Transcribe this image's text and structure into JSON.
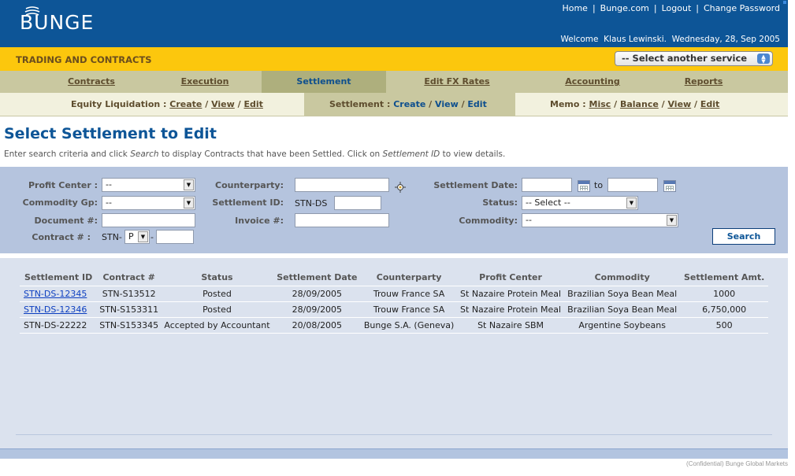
{
  "header": {
    "logo_text": "BUNGE",
    "links": [
      "Home",
      "Bunge.com",
      "Logout",
      "Change Password"
    ],
    "welcome": "Welcome  Klaus Lewinski.  Wednesday, 28, Sep 2005"
  },
  "service_bar": {
    "title": "TRADING AND CONTRACTS",
    "select_value": "-- Select another service"
  },
  "main_nav": [
    {
      "label": "Contracts"
    },
    {
      "label": "Execution"
    },
    {
      "label": "Settlement",
      "active": true
    },
    {
      "label": "Edit FX Rates"
    },
    {
      "label": "Accounting"
    },
    {
      "label": "Reports"
    }
  ],
  "sub_nav": {
    "equity": {
      "label": "Equity Liquidation :",
      "links": [
        "Create",
        "View",
        "Edit"
      ]
    },
    "settlement": {
      "label": "Settlement :",
      "links": [
        "Create",
        "View",
        "Edit"
      ]
    },
    "memo": {
      "label": "Memo :",
      "links": [
        "Misc",
        "Balance",
        "View",
        "Edit"
      ]
    }
  },
  "page": {
    "title": "Select Settlement to Edit",
    "instr_1": "Enter search criteria and click ",
    "instr_search": "Search",
    "instr_2": " to display Contracts that have been Settled. Click on ",
    "instr_sid": "Settlement ID",
    "instr_3": " to view details."
  },
  "search": {
    "profit_center_label": "Profit Center :",
    "profit_center_value": "--",
    "commodity_gp_label": "Commodity Gp:",
    "commodity_gp_value": "--",
    "document_label": "Document #:",
    "document_value": "",
    "contract_label": "Contract # :",
    "contract_prefix": "STN-",
    "contract_type_value": "P",
    "contract_dash": "-",
    "contract_value": "",
    "counterparty_label": "Counterparty:",
    "counterparty_value": "",
    "settlement_id_label": "Settlement ID:",
    "settlement_id_prefix": "STN-DS",
    "settlement_id_value": "",
    "invoice_label": "Invoice #:",
    "invoice_value": "",
    "settlement_date_label": "Settlement Date:",
    "date_from_value": "",
    "date_to_label": "to",
    "date_to_value": "",
    "status_label": "Status:",
    "status_value": "-- Select --",
    "commodity_label": "Commodity:",
    "commodity_value": "--",
    "search_button": "Search"
  },
  "results": {
    "columns": [
      "Settlement ID",
      "Contract #",
      "Status",
      "Settlement Date",
      "Counterparty",
      "Profit Center",
      "Commodity",
      "Settlement Amt."
    ],
    "rows": [
      [
        "STN-DS-12345",
        "STN-S13512",
        "Posted",
        "28/09/2005",
        "Trouw France SA",
        "St Nazaire Protein Meal",
        "Brazilian Soya Bean Meal",
        "1000"
      ],
      [
        "STN-DS-12346",
        "STN-S153311",
        "Posted",
        "28/09/2005",
        "Trouw France SA",
        "St Nazaire Protein Meal",
        "Brazilian Soya Bean Meal",
        "6,750,000"
      ],
      [
        "STN-DS-22222",
        "STN-S153345",
        "Accepted by Accountant",
        "20/08/2005",
        "Bunge S.A. (Geneva)",
        "St Nazaire SBM",
        "Argentine Soybeans",
        "500"
      ]
    ]
  },
  "footer": {
    "confidential": "(Confidential) Bunge Global Markets"
  },
  "colors": {
    "header_blue": "#0d5597",
    "service_yellow": "#fcc70d",
    "nav_olive": "#c9c8a0",
    "search_panel": "#b5c4de",
    "results_panel": "#dbe2ee"
  }
}
